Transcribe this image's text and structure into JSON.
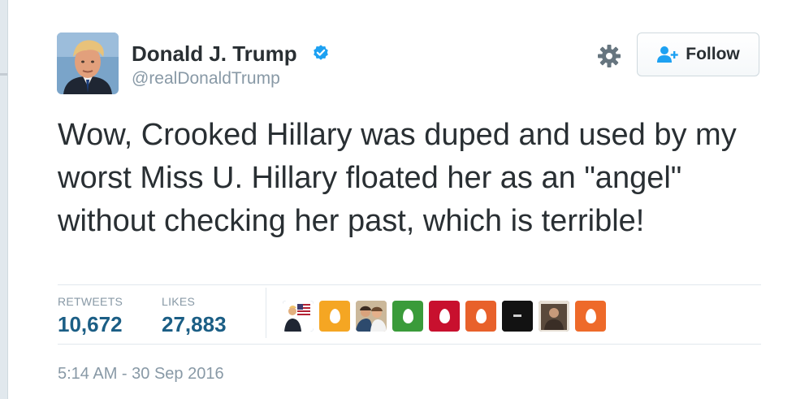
{
  "user": {
    "name": "Donald J. Trump",
    "handle": "@realDonaldTrump",
    "verified": true
  },
  "follow_button": {
    "label": "Follow",
    "icon": "add-user-icon"
  },
  "settings_icon": "gear-icon",
  "tweet": {
    "text": "Wow, Crooked Hillary was duped and used by my worst Miss U. Hillary floated her as an \"angel\" without checking her past, which is terrible!",
    "timestamp": "5:14 AM - 30 Sep 2016"
  },
  "stats": {
    "retweets_label": "RETWEETS",
    "retweets_count": "10,672",
    "likes_label": "LIKES",
    "likes_count": "27,883"
  },
  "colors": {
    "text": "#292f33",
    "muted": "#8899a6",
    "stat_value": "#1b5e85",
    "verified": "#1da1f2",
    "follow_icon": "#1da1f2"
  },
  "liker_avatars": [
    {
      "kind": "photo",
      "icon": "flag-photo",
      "color": "#3b5a8a"
    },
    {
      "kind": "egg",
      "icon": "egg-icon",
      "color": "#f5a623"
    },
    {
      "kind": "photo",
      "icon": "people-photo",
      "color": "#b39a7c"
    },
    {
      "kind": "egg",
      "icon": "egg-icon",
      "color": "#3a9b3a"
    },
    {
      "kind": "egg",
      "icon": "egg-icon",
      "color": "#c8102e"
    },
    {
      "kind": "egg",
      "icon": "egg-icon",
      "color": "#e8612b"
    },
    {
      "kind": "photo",
      "icon": "dark-photo",
      "color": "#1a1a1a"
    },
    {
      "kind": "photo",
      "icon": "portrait-photo",
      "color": "#6b5a4c"
    },
    {
      "kind": "egg",
      "icon": "egg-icon",
      "color": "#ee6a2a"
    }
  ]
}
